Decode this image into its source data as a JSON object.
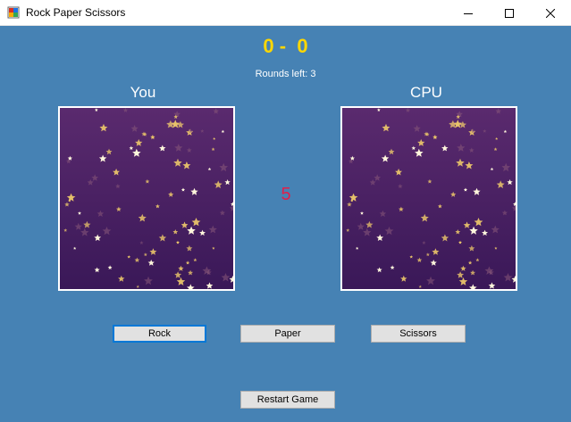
{
  "window": {
    "title": "Rock Paper Scissors",
    "icon": "winforms-app-icon",
    "controls": [
      "minimize-icon",
      "maximize-icon",
      "close-icon"
    ]
  },
  "game": {
    "score_display": "0 -  0",
    "rounds_left": "Rounds left: 3",
    "player_label": "You",
    "cpu_label": "CPU",
    "countdown": "5"
  },
  "buttons": {
    "rock": "Rock",
    "paper": "Paper",
    "scissors": "Scissors",
    "restart": "Restart Game"
  },
  "colors": {
    "background": "#4682b4",
    "score": "#ffd700",
    "countdown": "#e0204a",
    "focus_border": "#0078d7",
    "star_bg_top": "#5a2a6e",
    "star_bg_bottom": "#3a1858",
    "star_gold": "#e9c46a"
  }
}
